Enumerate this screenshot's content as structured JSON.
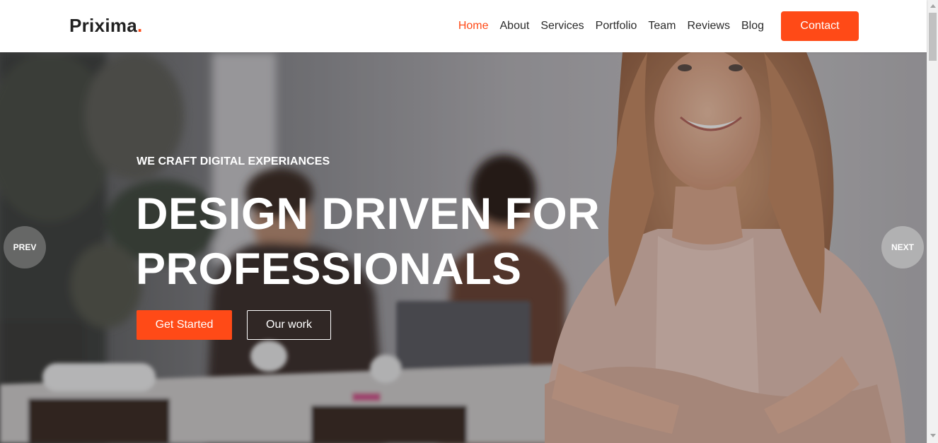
{
  "header": {
    "logo_text": "Prixima",
    "logo_dot": ".",
    "nav": [
      {
        "label": "Home",
        "active": true
      },
      {
        "label": "About"
      },
      {
        "label": "Services"
      },
      {
        "label": "Portfolio"
      },
      {
        "label": "Team"
      },
      {
        "label": "Reviews"
      },
      {
        "label": "Blog"
      }
    ],
    "contact_label": "Contact"
  },
  "hero": {
    "eyebrow": "WE CRAFT DIGITAL EXPERIANCES",
    "title_line1": "DESIGN DRIVEN FOR",
    "title_line2": "PROFESSIONALS",
    "primary_cta": "Get Started",
    "secondary_cta": "Our work",
    "prev_label": "PREV",
    "next_label": "NEXT",
    "background_image": "office-team-woman-smiling-photo"
  },
  "colors": {
    "accent": "#ff4a17",
    "text_dark": "#212121",
    "white": "#ffffff"
  }
}
